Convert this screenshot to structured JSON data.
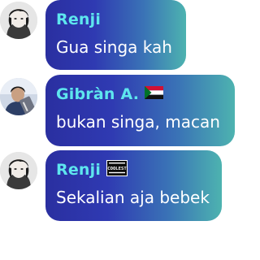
{
  "messages": [
    {
      "author": "Renji",
      "text": "Gua singa kah",
      "badge_icon": ""
    },
    {
      "author": "Gibràn A.",
      "text": "bukan singa, macan",
      "badge_icon": "sudan-flag-icon"
    },
    {
      "author": "Renji",
      "text": "Sekalian aja bebek",
      "badge_icon": "coolest-badge-icon"
    }
  ],
  "badges": {
    "coolest_text": "COOLEST"
  },
  "colors": {
    "author_name": "#5ee6ee",
    "bubble_start": "#2a2fa0",
    "bubble_end": "#4db3b0"
  }
}
